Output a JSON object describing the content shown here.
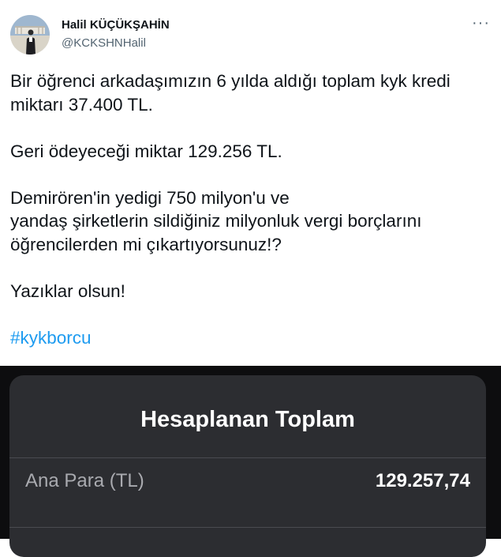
{
  "user": {
    "name": "Halil KÜÇÜKŞAHİN",
    "handle": "@KCKSHNHalil",
    "avatar_icon": "person-photo"
  },
  "menu": {
    "more_label": "···"
  },
  "tweet": {
    "line1": "Bir öğrenci arkadaşımızın 6 yılda aldığı toplam kyk kredi",
    "line2": "miktarı 37.400 TL.",
    "line3": "Geri ödeyeceği miktar 129.256 TL.",
    "line4": "Demirören'in yedigi 750 milyon'u ve",
    "line5": "yandaş şirketlerin sildiğiniz milyonluk vergi borçlarını",
    "line6": "öğrencilerden mi çıkartıyorsunuz!?",
    "line7": "Yazıklar olsun!",
    "hashtag": "#kykborcu"
  },
  "calculator": {
    "title": "Hesaplanan Toplam",
    "rows": [
      {
        "label": "Ana Para (TL)",
        "value": "129.257,74"
      }
    ]
  },
  "colors": {
    "link": "#1d9bf0",
    "card_background": "#2c2d31",
    "dark_background": "#0d0d0f"
  }
}
